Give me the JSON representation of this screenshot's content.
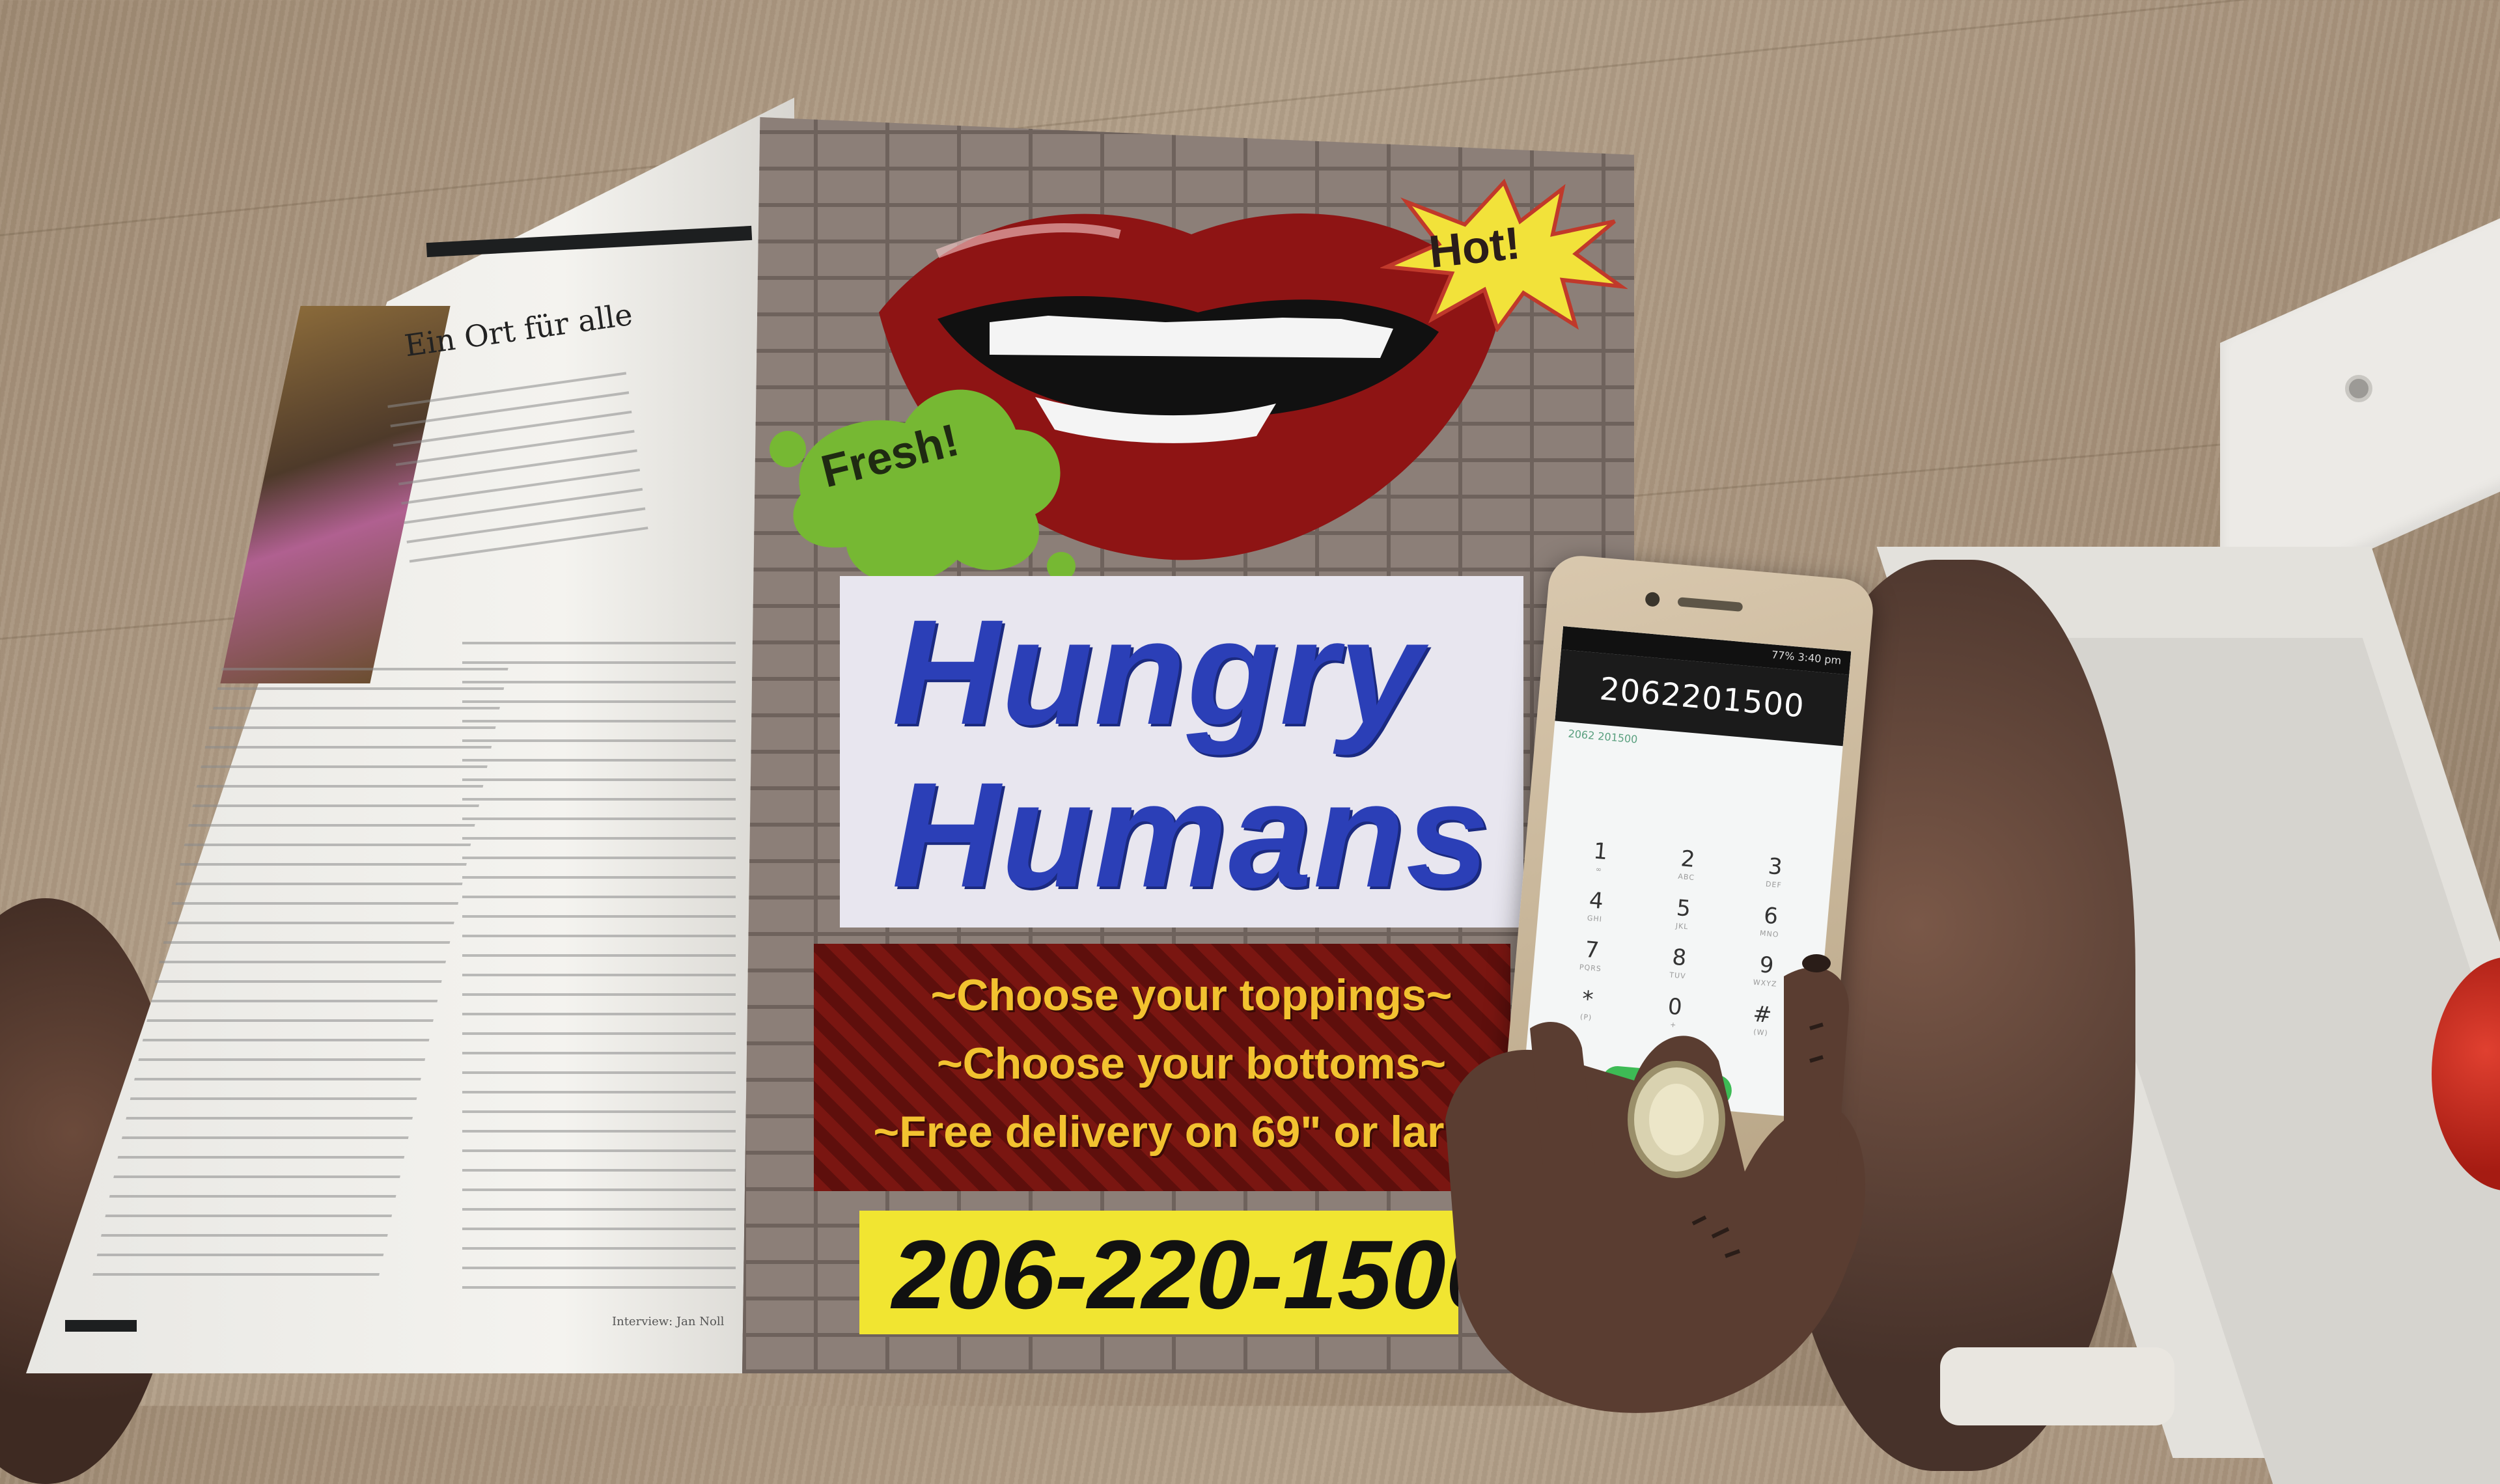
{
  "magazine": {
    "heading": "Ein Ort für alle",
    "credit": "Interview: Jan Noll"
  },
  "ad": {
    "burst_hot": "Hot!",
    "burst_fresh": "Fresh!",
    "title_line1": "Hungry",
    "title_line2": "Humans",
    "taglines": [
      "~Choose your toppings~",
      "~Choose your bottoms~",
      "~Free delivery on 69\" or lar"
    ],
    "phone_number": "206-220-1500"
  },
  "smartphone": {
    "status": "77% 3:40 pm",
    "dialed_number": "2062201500",
    "dialed_sub": "2062 201500",
    "keys": [
      {
        "digit": "1",
        "letters": "∞"
      },
      {
        "digit": "2",
        "letters": "ABC"
      },
      {
        "digit": "3",
        "letters": "DEF"
      },
      {
        "digit": "4",
        "letters": "GHI"
      },
      {
        "digit": "5",
        "letters": "JKL"
      },
      {
        "digit": "6",
        "letters": "MNO"
      },
      {
        "digit": "7",
        "letters": "PQRS"
      },
      {
        "digit": "8",
        "letters": "TUV"
      },
      {
        "digit": "9",
        "letters": "WXYZ"
      },
      {
        "digit": "*",
        "letters": "(P)"
      },
      {
        "digit": "0",
        "letters": "+"
      },
      {
        "digit": "#",
        "letters": "(W)"
      }
    ],
    "nav_back_icon": "◁"
  },
  "colors": {
    "ad_title": "#2b3fb7",
    "tagline_text": "#f2c230",
    "phone_box": "#f1e531"
  }
}
